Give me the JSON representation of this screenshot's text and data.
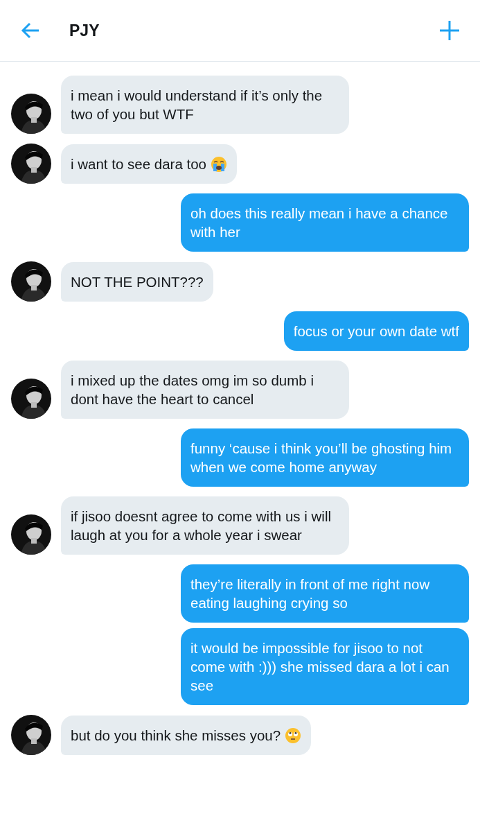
{
  "header": {
    "title": "PJY"
  },
  "messages": [
    {
      "kind": "received",
      "text": "i mean i would understand if it’s only the two of you but WTF"
    },
    {
      "kind": "received",
      "text": "i want to see dara too",
      "emoji": {
        "kind": "crying"
      }
    },
    {
      "kind": "sent",
      "text": "oh does this really mean i have a chance with her"
    },
    {
      "kind": "received",
      "text": "NOT THE POINT???"
    },
    {
      "kind": "sent",
      "text": "focus or your own date wtf"
    },
    {
      "kind": "received",
      "text": "i mixed up the dates omg im so dumb i dont have the heart to cancel"
    },
    {
      "kind": "sent",
      "text": "funny ‘cause i think you’ll be ghosting him when we come home anyway"
    },
    {
      "kind": "received",
      "text": "if jisoo doesnt agree to come with us i will laugh at you for a whole year i swear"
    },
    {
      "kind": "sent",
      "text": "they’re literally in front of me right now eating laughing crying so"
    },
    {
      "kind": "sent",
      "text": "it would be impossible for jisoo to not come with :))) she missed dara a lot i can see"
    },
    {
      "kind": "received",
      "text": "but do you think she misses you?",
      "emoji": {
        "kind": "eye-roll"
      }
    }
  ]
}
